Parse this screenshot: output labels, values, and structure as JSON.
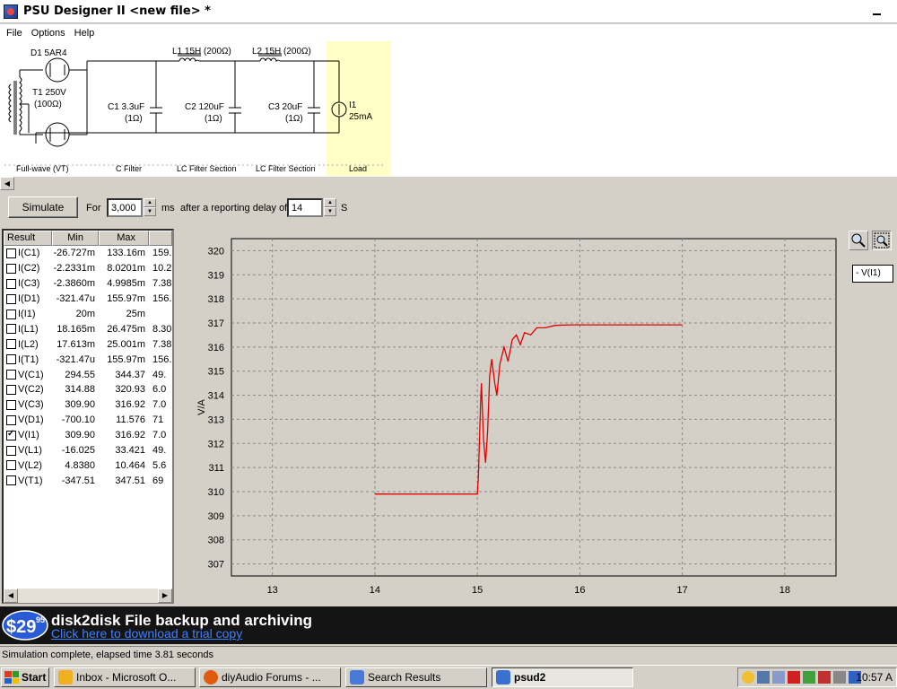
{
  "window": {
    "title": "PSU Designer II  <new file> *"
  },
  "menu": [
    "File",
    "Options",
    "Help"
  ],
  "schematic": {
    "components": {
      "d1": "D1 5AR4",
      "t1_a": "T1 250V",
      "t1_b": "(100Ω)",
      "l1": "L1 15H (200Ω)",
      "l2": "L2 15H (200Ω)",
      "c1_a": "C1 3.3uF",
      "c1_b": "(1Ω)",
      "c2_a": "C2 120uF",
      "c2_b": "(1Ω)",
      "c3_a": "C3 20uF",
      "c3_b": "(1Ω)",
      "i1_a": "I1",
      "i1_b": "25mA"
    },
    "sections": [
      "Full-wave (VT)",
      "C Filter",
      "LC Filter Section",
      "LC Filter Section",
      "Load"
    ],
    "colors": {
      "load_bg": "#ffffc6"
    }
  },
  "controls": {
    "simulate": "Simulate",
    "for_label": "For",
    "duration": "3,000",
    "ms_label": "ms",
    "delay_label": "after a reporting delay of",
    "delay": "14",
    "s_label": "S"
  },
  "results": {
    "headers": [
      "Result",
      "Min",
      "Max",
      ""
    ],
    "rows": [
      {
        "name": "I(C1)",
        "min": "-26.727m",
        "max": "133.16m",
        "extra": "159.",
        "checked": false
      },
      {
        "name": "I(C2)",
        "min": "-2.2331m",
        "max": "8.0201m",
        "extra": "10.2",
        "checked": false
      },
      {
        "name": "I(C3)",
        "min": "-2.3860m",
        "max": "4.9985m",
        "extra": "7.38",
        "checked": false
      },
      {
        "name": "I(D1)",
        "min": "-321.47u",
        "max": "155.97m",
        "extra": "156.",
        "checked": false
      },
      {
        "name": "I(I1)",
        "min": "20m",
        "max": "25m",
        "extra": "",
        "checked": false
      },
      {
        "name": "I(L1)",
        "min": "18.165m",
        "max": "26.475m",
        "extra": "8.30",
        "checked": false
      },
      {
        "name": "I(L2)",
        "min": "17.613m",
        "max": "25.001m",
        "extra": "7.38",
        "checked": false
      },
      {
        "name": "I(T1)",
        "min": "-321.47u",
        "max": "155.97m",
        "extra": "156.",
        "checked": false
      },
      {
        "name": "V(C1)",
        "min": "294.55",
        "max": "344.37",
        "extra": "49.",
        "checked": false
      },
      {
        "name": "V(C2)",
        "min": "314.88",
        "max": "320.93",
        "extra": "6.0",
        "checked": false
      },
      {
        "name": "V(C3)",
        "min": "309.90",
        "max": "316.92",
        "extra": "7.0",
        "checked": false
      },
      {
        "name": "V(D1)",
        "min": "-700.10",
        "max": "11.576",
        "extra": "71",
        "checked": false
      },
      {
        "name": "V(I1)",
        "min": "309.90",
        "max": "316.92",
        "extra": "7.0",
        "checked": true
      },
      {
        "name": "V(L1)",
        "min": "-16.025",
        "max": "33.421",
        "extra": "49.",
        "checked": false
      },
      {
        "name": "V(L2)",
        "min": "4.8380",
        "max": "10.464",
        "extra": "5.6",
        "checked": false
      },
      {
        "name": "V(T1)",
        "min": "-347.51",
        "max": "347.51",
        "extra": "69",
        "checked": false
      }
    ]
  },
  "chart_data": {
    "type": "line",
    "ylabel": "V/A",
    "xlabel": "",
    "xlim": [
      12.6,
      18.5
    ],
    "ylim": [
      306.5,
      320.5
    ],
    "xticks": [
      13,
      14,
      15,
      16,
      17,
      18
    ],
    "yticks": [
      307,
      308,
      309,
      310,
      311,
      312,
      313,
      314,
      315,
      316,
      317,
      318,
      319,
      320
    ],
    "grid": true,
    "legend": "right",
    "series": [
      {
        "name": "V(I1)",
        "color": "#e00000",
        "points": [
          [
            14.0,
            309.9
          ],
          [
            15.0,
            309.9
          ],
          [
            15.01,
            310.6
          ],
          [
            15.03,
            313.5
          ],
          [
            15.04,
            314.5
          ],
          [
            15.06,
            312.2
          ],
          [
            15.08,
            311.2
          ],
          [
            15.1,
            312.5
          ],
          [
            15.12,
            314.8
          ],
          [
            15.14,
            315.5
          ],
          [
            15.17,
            314.5
          ],
          [
            15.19,
            314.0
          ],
          [
            15.22,
            315.3
          ],
          [
            15.26,
            316.0
          ],
          [
            15.3,
            315.4
          ],
          [
            15.34,
            316.3
          ],
          [
            15.38,
            316.5
          ],
          [
            15.42,
            316.1
          ],
          [
            15.46,
            316.6
          ],
          [
            15.52,
            316.5
          ],
          [
            15.58,
            316.8
          ],
          [
            15.66,
            316.8
          ],
          [
            15.76,
            316.9
          ],
          [
            15.9,
            316.92
          ],
          [
            16.2,
            316.92
          ],
          [
            17.0,
            316.92
          ]
        ]
      }
    ],
    "legend_entries": [
      "- V(I1)"
    ]
  },
  "ad": {
    "price": "$29",
    "cents": "95",
    "title": "disk2disk File backup and archiving",
    "link": "Click here to download a trial copy"
  },
  "status": "Simulation complete, elapsed time 3.81 seconds",
  "taskbar": {
    "start": "Start",
    "tasks": [
      {
        "label": "Inbox - Microsoft O...",
        "active": false,
        "color": "#f0b020"
      },
      {
        "label": "diyAudio Forums - ...",
        "active": false,
        "color": "#e05a10"
      },
      {
        "label": "Search Results",
        "active": false,
        "color": "#4a7ad8"
      },
      {
        "label": "psud2",
        "active": true,
        "color": "#3b6fd1"
      }
    ],
    "clock": "10:57 A"
  }
}
